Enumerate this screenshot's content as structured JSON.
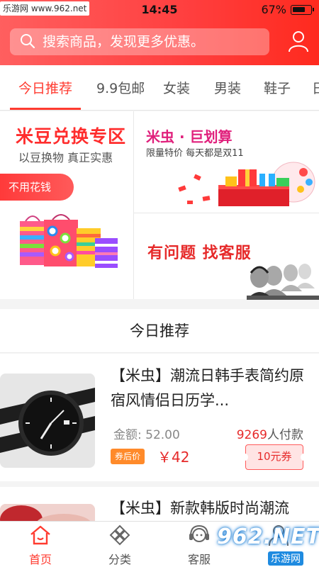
{
  "status_bar": {
    "watermark": "乐游网 www.962.net",
    "time": "14:45",
    "battery": "67%"
  },
  "search": {
    "placeholder": "搜索商品，发现更多优惠。"
  },
  "tabs": [
    "今日推荐",
    "9.9包邮",
    "女装",
    "男装",
    "鞋子",
    "日"
  ],
  "promo": {
    "exchange_title": "米豆兑换专区",
    "exchange_subtitle": "以豆换物 真正实惠",
    "exchange_button": "不用花钱",
    "deal_title": "米虫 · 巨划算",
    "deal_subtitle": "限量特价 每天都是双11",
    "service_title": "有问题 找客服"
  },
  "section_title": "今日推荐",
  "products": [
    {
      "title": "【米虫】潮流日韩手表简约原宿风情侣日历学...",
      "amount": "金额: 52.00",
      "paid_count": "9269",
      "paid_suffix": "人付款",
      "badge": "券后价",
      "price": "￥42",
      "coupon": "10元券"
    },
    {
      "title": "【米虫】新款韩版时尚潮流"
    }
  ],
  "tabbar": [
    {
      "label": "首页",
      "icon": "home-icon"
    },
    {
      "label": "分类",
      "icon": "category-icon"
    },
    {
      "label": "客服",
      "icon": "headset-icon"
    },
    {
      "label": "",
      "icon": "profile-icon"
    }
  ],
  "watermark": {
    "logo": "962.NET",
    "sub": "乐游网"
  },
  "colors": {
    "accent": "#ff3b30",
    "header_start": "#ff5f5f",
    "header_end": "#ff2a1e",
    "coupon_badge": "#ff8a2a"
  }
}
